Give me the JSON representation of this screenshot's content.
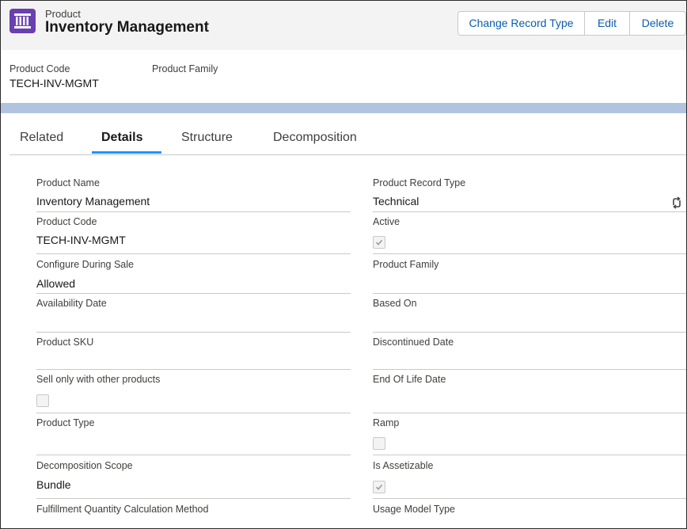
{
  "header": {
    "object_label": "Product",
    "record_title": "Inventory Management",
    "buttons": {
      "change_record_type": "Change Record Type",
      "edit": "Edit",
      "delete": "Delete"
    }
  },
  "highlights": [
    {
      "label": "Product Code",
      "value": "TECH-INV-MGMT"
    },
    {
      "label": "Product Family",
      "value": ""
    }
  ],
  "tabs": [
    "Related",
    "Details",
    "Structure",
    "Decomposition"
  ],
  "active_tab": "Details",
  "details": {
    "left": [
      {
        "label": "Product Name",
        "value": "Inventory Management"
      },
      {
        "label": "Product Code",
        "value": "TECH-INV-MGMT"
      },
      {
        "label": "Configure During Sale",
        "value": "Allowed"
      },
      {
        "label": "Availability Date",
        "value": ""
      },
      {
        "label": "Product SKU",
        "value": ""
      },
      {
        "label": "Sell only with other products",
        "checkbox": false
      },
      {
        "label": "Product Type",
        "value": ""
      },
      {
        "label": "Decomposition Scope",
        "value": "Bundle"
      },
      {
        "label": "Fulfillment Quantity Calculation Method",
        "value": ""
      }
    ],
    "right": [
      {
        "label": "Product Record Type",
        "value": "Technical"
      },
      {
        "label": "Active",
        "checkbox": true
      },
      {
        "label": "Product Family",
        "value": ""
      },
      {
        "label": "Based On",
        "value": ""
      },
      {
        "label": "Discontinued Date",
        "value": ""
      },
      {
        "label": "End Of Life Date",
        "value": ""
      },
      {
        "label": "Ramp",
        "checkbox": false
      },
      {
        "label": "Is Assetizable",
        "checkbox": true
      },
      {
        "label": "Usage Model Type",
        "value": ""
      }
    ]
  },
  "icons": {
    "object": "product-icon",
    "record_type_edit": "change-record-type-icon"
  },
  "colors": {
    "accent": "#0b5cab",
    "icon_bg": "#6a3fb0",
    "band": "#b0c4df",
    "tab_underline": "#1b96ff"
  }
}
